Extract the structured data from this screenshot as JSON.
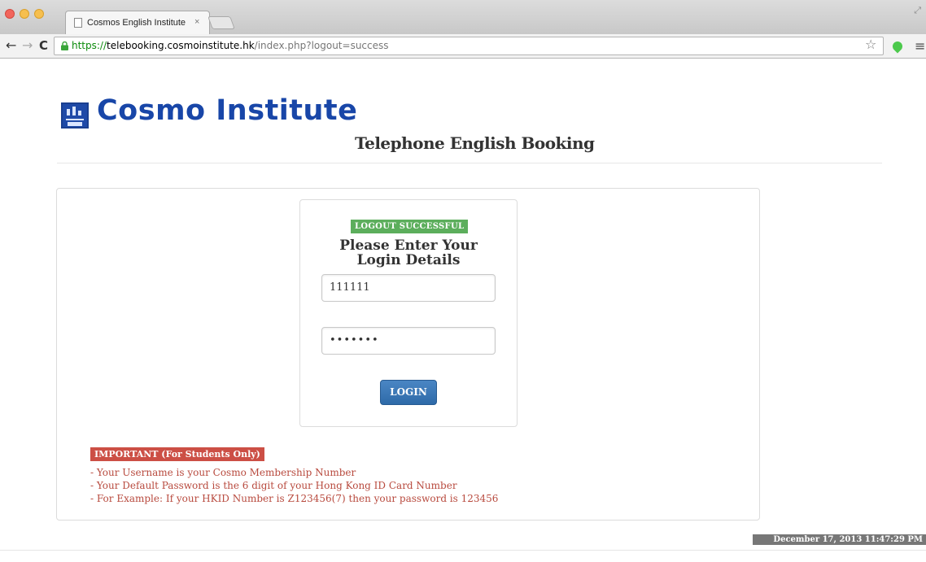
{
  "browser": {
    "tab_title": "Cosmos English Institute",
    "tab_close": "×",
    "url_scheme": "https://",
    "url_host": "telebooking.cosmoinstitute.hk",
    "url_path": "/index.php?logout=success"
  },
  "header": {
    "logo_text": "Cosmo Institute",
    "subtitle": "Telephone English Booking"
  },
  "login": {
    "status_badge": "LOGOUT SUCCESSFUL",
    "heading_line1": "Please Enter Your",
    "heading_line2": "Login Details",
    "username_value": "111111",
    "password_value": "•••••••",
    "login_label": "LOGIN"
  },
  "notice": {
    "badge": "IMPORTANT (For Students Only)",
    "lines": [
      "- Your Username is your Cosmo Membership Number",
      "- Your Default Password is the 6 digit of your Hong Kong ID Card Number",
      "- For Example: If your HKID Number is Z123456(7) then your password is 123456"
    ]
  },
  "footer": {
    "timestamp": "December 17, 2013 11:47:29 PM"
  },
  "colors": {
    "brand_blue": "#1846a8",
    "success_green": "#5cae5c",
    "important_red": "#cc4f45",
    "notice_text": "#b84a3e",
    "button_blue": "#3a78b8"
  },
  "icons": [
    "page-icon",
    "lock-icon",
    "star-icon",
    "extension-icon",
    "menu-icon",
    "back-icon",
    "forward-icon",
    "reload-icon"
  ]
}
